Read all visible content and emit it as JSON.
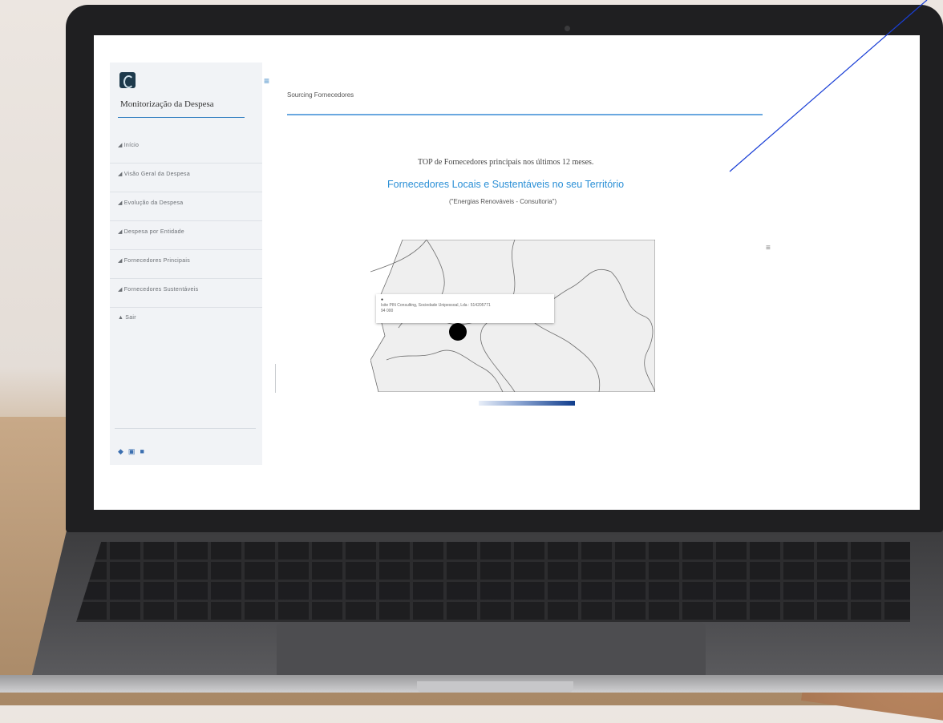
{
  "app": {
    "title": "Monitorização da Despesa"
  },
  "sidebar": {
    "items": [
      {
        "label": "Início"
      },
      {
        "label": "Visão Geral da Despesa"
      },
      {
        "label": "Evolução da Despesa"
      },
      {
        "label": "Despesa por Entidade"
      },
      {
        "label": "Fornecedores Principais"
      },
      {
        "label": "Fornecedores Sustentáveis"
      },
      {
        "label": "Sair"
      }
    ],
    "bottom_icons": [
      "home-icon",
      "document-icon",
      "bookmark-icon"
    ]
  },
  "header": {
    "page_title": "Sourcing Fornecedores"
  },
  "content": {
    "heading_primary": "TOP de Fornecedores principais nos últimos 12 meses.",
    "heading_secondary": "Fornecedores Locais e Sustentáveis no seu Território",
    "heading_filter": "(\"Energias Renováveis - Consultoria\")"
  },
  "map": {
    "tooltip_bullet": "●",
    "tooltip_line1": "Isite PIN Consulting, Sociedade Unipessoal, Lda : 514205771",
    "tooltip_line2": "94 000",
    "legend_colors": [
      "#e8eef8",
      "#8fa8d4",
      "#0f3c8c"
    ]
  },
  "colors": {
    "accent": "#2a8fd6",
    "rule": "#6aa8e0",
    "sidebar_bg": "#f1f3f6"
  }
}
